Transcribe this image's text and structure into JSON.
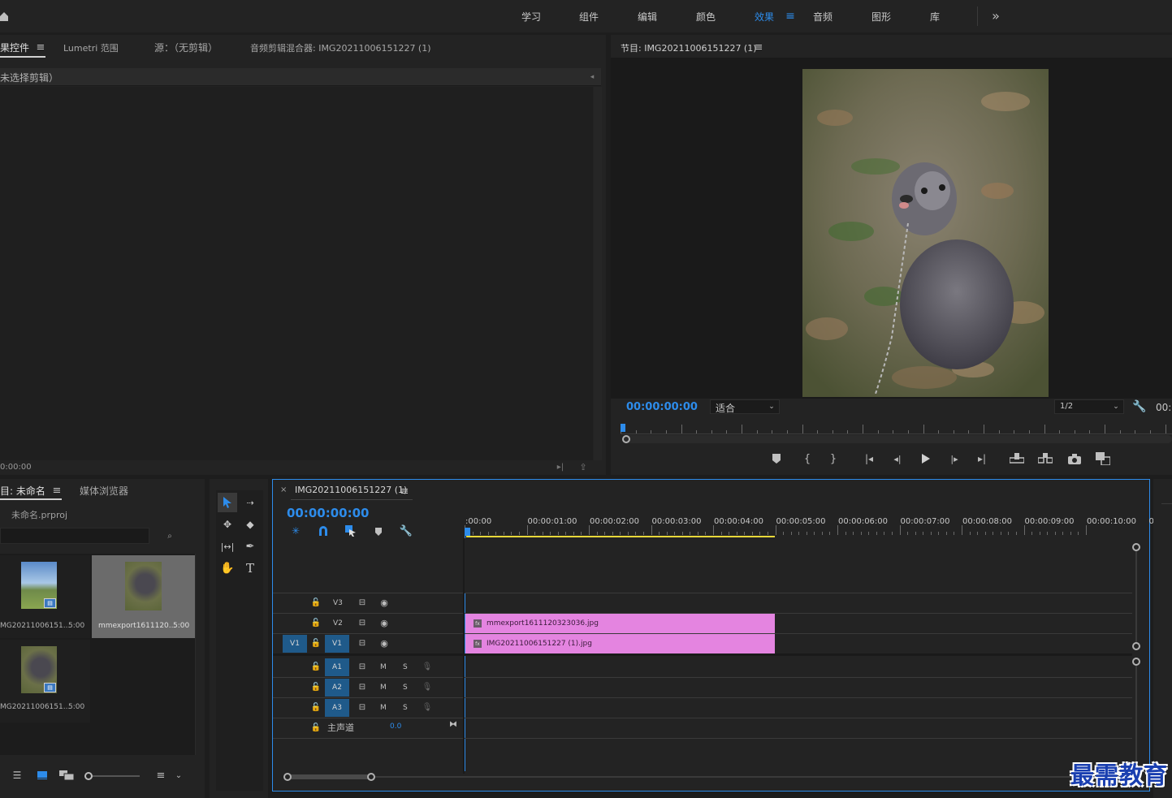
{
  "workspace_tabs": [
    {
      "label": "学习"
    },
    {
      "label": "组件"
    },
    {
      "label": "编辑"
    },
    {
      "label": "颜色"
    },
    {
      "label": "效果"
    },
    {
      "label": "音频"
    },
    {
      "label": "图形"
    },
    {
      "label": "库"
    }
  ],
  "effect_controls": {
    "tabs": [
      "果控件",
      "Lumetri 范围",
      "源：（无剪辑）",
      "音频剪辑混合器: IMG20211006151227 (1)"
    ],
    "no_clip": "未选择剪辑）",
    "timecode": "0:00:00"
  },
  "program_monitor": {
    "title": "节目: IMG20211006151227 (1)",
    "timecode": "00:00:00:00",
    "fit_value": "适合",
    "resolution_value": "1/2",
    "timecode_right": "00:"
  },
  "project": {
    "tabs": [
      "目: 未命名",
      "媒体浏览器"
    ],
    "file_name": "未命名.prproj",
    "items": [
      {
        "name": "MG20211006151...",
        "duration": "5:00"
      },
      {
        "name": "mmexport1611120...",
        "duration": "5:00"
      },
      {
        "name": "MG20211006151...",
        "duration": "5:00"
      }
    ]
  },
  "timeline": {
    "tab_close": "×",
    "title": "IMG20211006151227 (1)",
    "timecode": "00:00:00:00",
    "ruler": [
      ":00:00",
      "00:00:01:00",
      "00:00:02:00",
      "00:00:03:00",
      "00:00:04:00",
      "00:00:05:00",
      "00:00:06:00",
      "00:00:07:00",
      "00:00:08:00",
      "00:00:09:00",
      "00:00:10:00",
      "0"
    ],
    "video_tracks": [
      "V3",
      "V2",
      "V1"
    ],
    "source_patch": "V1",
    "audio_tracks": [
      "A1",
      "A2",
      "A3"
    ],
    "mute_label": "M",
    "solo_label": "S",
    "master_label": "主声道",
    "master_value": "0.0",
    "clips": [
      {
        "name": "mmexport1611120323036.jpg",
        "track": "V2"
      },
      {
        "name": "IMG20211006151227 (1).jpg",
        "track": "V1"
      }
    ]
  },
  "watermark": "最需教育",
  "colors": {
    "accent": "#2d8ceb",
    "clip": "#e484e0",
    "track_target": "#1f5a8a",
    "work_area": "#e8d83a"
  }
}
